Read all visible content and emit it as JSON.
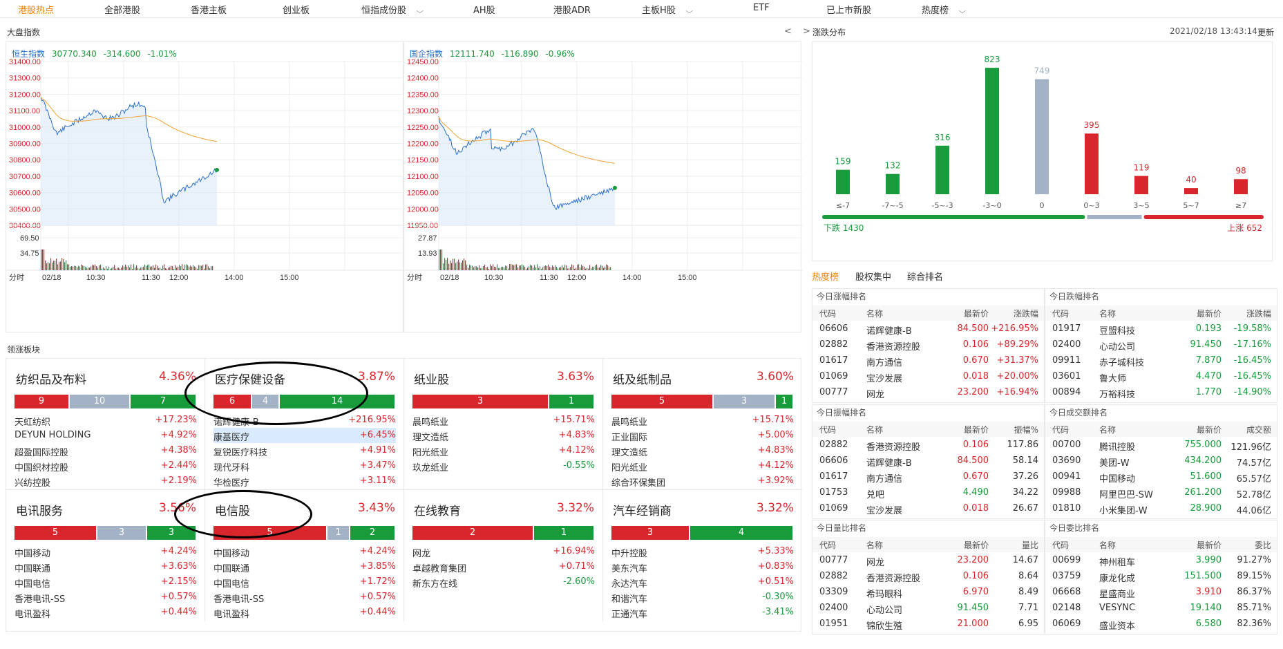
{
  "nav": {
    "items": [
      "港股热点",
      "全部港股",
      "香港主板",
      "创业板",
      "恒指成份股",
      "AH股",
      "港股ADR",
      "主板H股",
      "ETF",
      "已上市新股",
      "热度榜"
    ]
  },
  "market": {
    "title": "大盘指数",
    "nav_arrows": "< >"
  },
  "hsi": {
    "name": "恒生指数",
    "value": "30770.340",
    "change": "-314.600",
    "pct": "-1.01%",
    "yticks": [
      "31400.00",
      "31300.00",
      "31200.00",
      "31100.00",
      "31000.00",
      "30900.00",
      "30800.00",
      "30700.00",
      "30600.00",
      "30500.00",
      "30400.00"
    ],
    "vol_ticks": [
      "69.50",
      "34.75"
    ]
  },
  "hscei": {
    "name": "国企指数",
    "value": "12111.740",
    "change": "-116.890",
    "pct": "-0.96%",
    "yticks": [
      "12450.00",
      "12400.00",
      "12350.00",
      "12300.00",
      "12250.00",
      "12200.00",
      "12150.00",
      "12100.00",
      "12050.00",
      "12000.00",
      "11950.00"
    ],
    "vol_ticks": [
      "27.87",
      "13.93"
    ]
  },
  "xaxis": {
    "label": "分时",
    "ticks": [
      "02/18",
      "10:30",
      "11:30",
      "12:00",
      "14:00",
      "15:00"
    ]
  },
  "colors": {
    "red": "#d9262c",
    "green": "#179b3b",
    "gray": "#a3b2c5",
    "orange": "#f08300",
    "blue": "#2a6fc9"
  },
  "sectors": {
    "title": "领涨板块",
    "tiles": [
      {
        "name": "纺织品及布料",
        "pct": "4.36%",
        "bar": [
          {
            "t": "r",
            "v": "9",
            "w": 80
          },
          {
            "t": "s",
            "v": "10",
            "w": 88
          },
          {
            "t": "g",
            "v": "7",
            "w": 96
          }
        ],
        "rows": [
          [
            "天虹纺织",
            "+17.23%"
          ],
          [
            "DEYUN HOLDING",
            "+4.92%"
          ],
          [
            "超盈国际控股",
            "+4.38%"
          ],
          [
            "中国织材控股",
            "+2.44%"
          ],
          [
            "兴纺控股",
            "+2.19%"
          ]
        ]
      },
      {
        "name": "医疗保健设备",
        "pct": "3.87%",
        "bar": [
          {
            "t": "r",
            "v": "6",
            "w": 56
          },
          {
            "t": "s",
            "v": "4",
            "w": 40
          },
          {
            "t": "g",
            "v": "14",
            "w": 168
          }
        ],
        "rows": [
          [
            "诺辉健康-B",
            "+216.95%"
          ],
          [
            "康基医疗",
            "+6.45%"
          ],
          [
            "复锐医疗科技",
            "+4.91%"
          ],
          [
            "现代牙科",
            "+3.47%"
          ],
          [
            "华检医疗",
            "+3.11%"
          ]
        ],
        "hl": 1
      },
      {
        "name": "纸业股",
        "pct": "3.63%",
        "bar": [
          {
            "t": "r",
            "v": "3",
            "w": 198
          },
          {
            "t": "g",
            "v": "1",
            "w": 66
          }
        ],
        "rows": [
          [
            "晨鸣纸业",
            "+15.71%"
          ],
          [
            "理文造纸",
            "+4.83%"
          ],
          [
            "阳光纸业",
            "+4.12%"
          ],
          [
            "玖龙纸业",
            "-0.55%"
          ]
        ]
      },
      {
        "name": "纸及纸制品",
        "pct": "3.60%",
        "bar": [
          {
            "t": "r",
            "v": "5",
            "w": 148
          },
          {
            "t": "s",
            "v": "3",
            "w": 90
          },
          {
            "t": "g",
            "v": "1",
            "w": 26
          }
        ],
        "rows": [
          [
            "晨鸣纸业",
            "+15.71%"
          ],
          [
            "正业国际",
            "+5.00%"
          ],
          [
            "理文造纸",
            "+4.83%"
          ],
          [
            "阳光纸业",
            "+4.12%"
          ],
          [
            "综合环保集团",
            "+3.92%"
          ]
        ]
      },
      {
        "name": "电讯服务",
        "pct": "3.56%",
        "bar": [
          {
            "t": "r",
            "v": "5",
            "w": 120
          },
          {
            "t": "s",
            "v": "3",
            "w": 72
          },
          {
            "t": "g",
            "v": "3",
            "w": 72
          }
        ],
        "rows": [
          [
            "中国移动",
            "+4.24%"
          ],
          [
            "中国联通",
            "+3.63%"
          ],
          [
            "中国电信",
            "+2.15%"
          ],
          [
            "香港电讯-SS",
            "+0.57%"
          ],
          [
            "电讯盈科",
            "+0.44%"
          ]
        ]
      },
      {
        "name": "电信股",
        "pct": "3.43%",
        "bar": [
          {
            "t": "r",
            "v": "5",
            "w": 165
          },
          {
            "t": "s",
            "v": "1",
            "w": 33
          },
          {
            "t": "g",
            "v": "2",
            "w": 66
          }
        ],
        "rows": [
          [
            "中国移动",
            "+4.24%"
          ],
          [
            "中国联通",
            "+3.85%"
          ],
          [
            "中国电信",
            "+1.72%"
          ],
          [
            "香港电讯-SS",
            "+0.57%"
          ],
          [
            "电讯盈科",
            "+0.44%"
          ]
        ]
      },
      {
        "name": "在线教育",
        "pct": "3.32%",
        "bar": [
          {
            "t": "r",
            "v": "2",
            "w": 176
          },
          {
            "t": "g",
            "v": "1",
            "w": 88
          }
        ],
        "rows": [
          [
            "网龙",
            "+16.94%"
          ],
          [
            "卓越教育集团",
            "+0.71%"
          ],
          [
            "新东方在线",
            "-2.60%"
          ]
        ]
      },
      {
        "name": "汽车经销商",
        "pct": "3.32%",
        "bar": [
          {
            "t": "r",
            "v": "3",
            "w": 114
          },
          {
            "t": "g",
            "v": "4",
            "w": 150
          }
        ],
        "rows": [
          [
            "中升控股",
            "+5.33%"
          ],
          [
            "美东汽车",
            "+0.83%"
          ],
          [
            "永达汽车",
            "+0.51%"
          ],
          [
            "和谐汽车",
            "-0.30%"
          ],
          [
            "正通汽车",
            "-3.41%"
          ]
        ]
      }
    ]
  },
  "distribution": {
    "title": "涨跌分布",
    "datetime": "2021/02/18 13:43:14",
    "refresh": "更新",
    "down_label": "下跌 1430",
    "up_label": "上涨 652",
    "down_count": 1430,
    "up_count": 652
  },
  "chart_data": {
    "type": "bar",
    "categories": [
      "≤-7",
      "-7~-5",
      "-5~-3",
      "-3~0",
      "0",
      "0~3",
      "3~5",
      "5~7",
      "≥7"
    ],
    "values": [
      159,
      132,
      316,
      823,
      749,
      395,
      119,
      40,
      98
    ]
  },
  "heat_tabs": [
    "热度榜",
    "股权集中",
    "综合排名"
  ],
  "rankings": [
    {
      "title": "今日涨幅排名",
      "cols": [
        "代码",
        "名称",
        "最新价",
        "涨跌幅"
      ],
      "rows": [
        [
          "06606",
          "诺辉健康-B",
          "84.500",
          "+216.95%"
        ],
        [
          "02882",
          "香港资源控股",
          "0.106",
          "+89.29%"
        ],
        [
          "01617",
          "南方通信",
          "0.670",
          "+31.37%"
        ],
        [
          "01069",
          "宝沙发展",
          "0.018",
          "+20.00%"
        ],
        [
          "00777",
          "网龙",
          "23.200",
          "+16.94%"
        ]
      ],
      "pc": "red",
      "vc": "red"
    },
    {
      "title": "今日跌幅排名",
      "cols": [
        "代码",
        "名称",
        "最新价",
        "涨跌幅"
      ],
      "rows": [
        [
          "01917",
          "豆盟科技",
          "0.193",
          "-19.58%"
        ],
        [
          "02400",
          "心动公司",
          "91.450",
          "-17.16%"
        ],
        [
          "09911",
          "赤子城科技",
          "7.870",
          "-16.45%"
        ],
        [
          "03601",
          "鲁大师",
          "4.470",
          "-16.45%"
        ],
        [
          "00894",
          "万裕科技",
          "1.770",
          "-14.90%"
        ]
      ],
      "pc": "grn",
      "vc": "grn"
    },
    {
      "title": "今日振幅排名",
      "cols": [
        "代码",
        "名称",
        "最新价",
        "振幅%"
      ],
      "rows": [
        [
          "02882",
          "香港资源控股",
          "0.106",
          "117.86"
        ],
        [
          "06606",
          "诺辉健康-B",
          "84.500",
          "58.14"
        ],
        [
          "01617",
          "南方通信",
          "0.670",
          "37.26"
        ],
        [
          "01753",
          "兑吧",
          "4.490",
          "34.22"
        ],
        [
          "01069",
          "宝沙发展",
          "0.018",
          "26.67"
        ]
      ],
      "pc": [
        "red",
        "red",
        "red",
        "grn",
        "red"
      ],
      "vc": "blk"
    },
    {
      "title": "今日成交额排名",
      "cols": [
        "代码",
        "名称",
        "最新价",
        "成交额"
      ],
      "rows": [
        [
          "00700",
          "腾讯控股",
          "755.000",
          "121.96亿"
        ],
        [
          "03690",
          "美团-W",
          "434.200",
          "74.57亿"
        ],
        [
          "00941",
          "中国移动",
          "51.600",
          "65.57亿"
        ],
        [
          "09988",
          "阿里巴巴-SW",
          "261.200",
          "52.78亿"
        ],
        [
          "01810",
          "小米集团-W",
          "28.900",
          "44.06亿"
        ]
      ],
      "pc": "grn",
      "vc": "blk"
    },
    {
      "title": "今日量比排名",
      "cols": [
        "代码",
        "名称",
        "最新价",
        "量比"
      ],
      "rows": [
        [
          "00777",
          "网龙",
          "23.200",
          "14.67"
        ],
        [
          "02882",
          "香港资源控股",
          "0.106",
          "8.64"
        ],
        [
          "03309",
          "希玛眼科",
          "6.970",
          "8.49"
        ],
        [
          "02400",
          "心动公司",
          "91.450",
          "7.71"
        ],
        [
          "01951",
          "锦欣生殖",
          "21.000",
          "6.95"
        ]
      ],
      "pc": [
        "red",
        "red",
        "red",
        "grn",
        "red"
      ],
      "vc": "blk"
    },
    {
      "title": "今日委比排名",
      "cols": [
        "代码",
        "名称",
        "最新价",
        "委比"
      ],
      "rows": [
        [
          "00699",
          "神州租车",
          "3.990",
          "91.27%"
        ],
        [
          "03759",
          "康龙化成",
          "151.500",
          "89.15%"
        ],
        [
          "06668",
          "星盛商业",
          "3.910",
          "86.37%"
        ],
        [
          "02148",
          "VESYNC",
          "19.140",
          "85.71%"
        ],
        [
          "06069",
          "盛业资本",
          "6.580",
          "82.36%"
        ]
      ],
      "pc": [
        "grn",
        "grn",
        "red",
        "grn",
        "grn"
      ],
      "vc": "blk"
    }
  ]
}
